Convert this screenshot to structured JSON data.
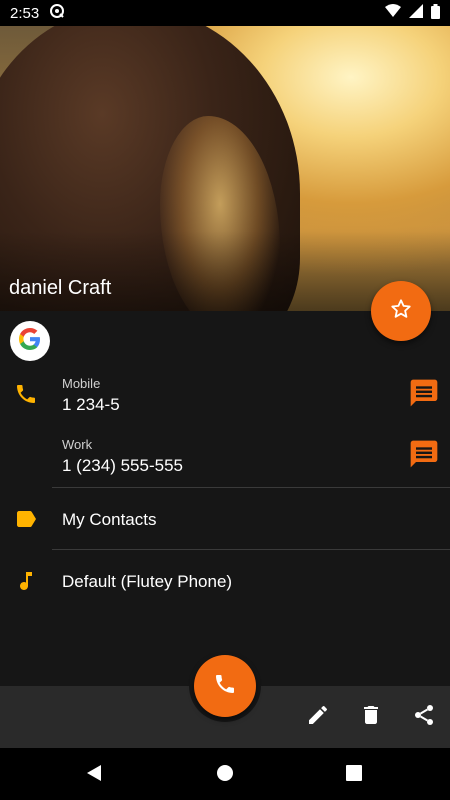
{
  "status_bar": {
    "time": "2:53"
  },
  "contact": {
    "name": "daniel Craft"
  },
  "phones": [
    {
      "label": "Mobile",
      "number": "1 234-5"
    },
    {
      "label": "Work",
      "number": "1 (234) 555-555"
    }
  ],
  "group": {
    "name": "My Contacts"
  },
  "ringtone": {
    "name": "Default (Flutey Phone)"
  },
  "icons": {
    "favorite": "star-outline-icon",
    "account": "google-icon",
    "phone": "phone-icon",
    "message": "message-icon",
    "label": "label-icon",
    "ringtone": "music-note-icon",
    "edit": "pencil-icon",
    "delete": "trash-icon",
    "share": "share-icon"
  },
  "colors": {
    "accent": "#f26b12",
    "icon_accent": "#ffb300",
    "background": "#161616",
    "bottom_bar": "#2a2a2a"
  }
}
